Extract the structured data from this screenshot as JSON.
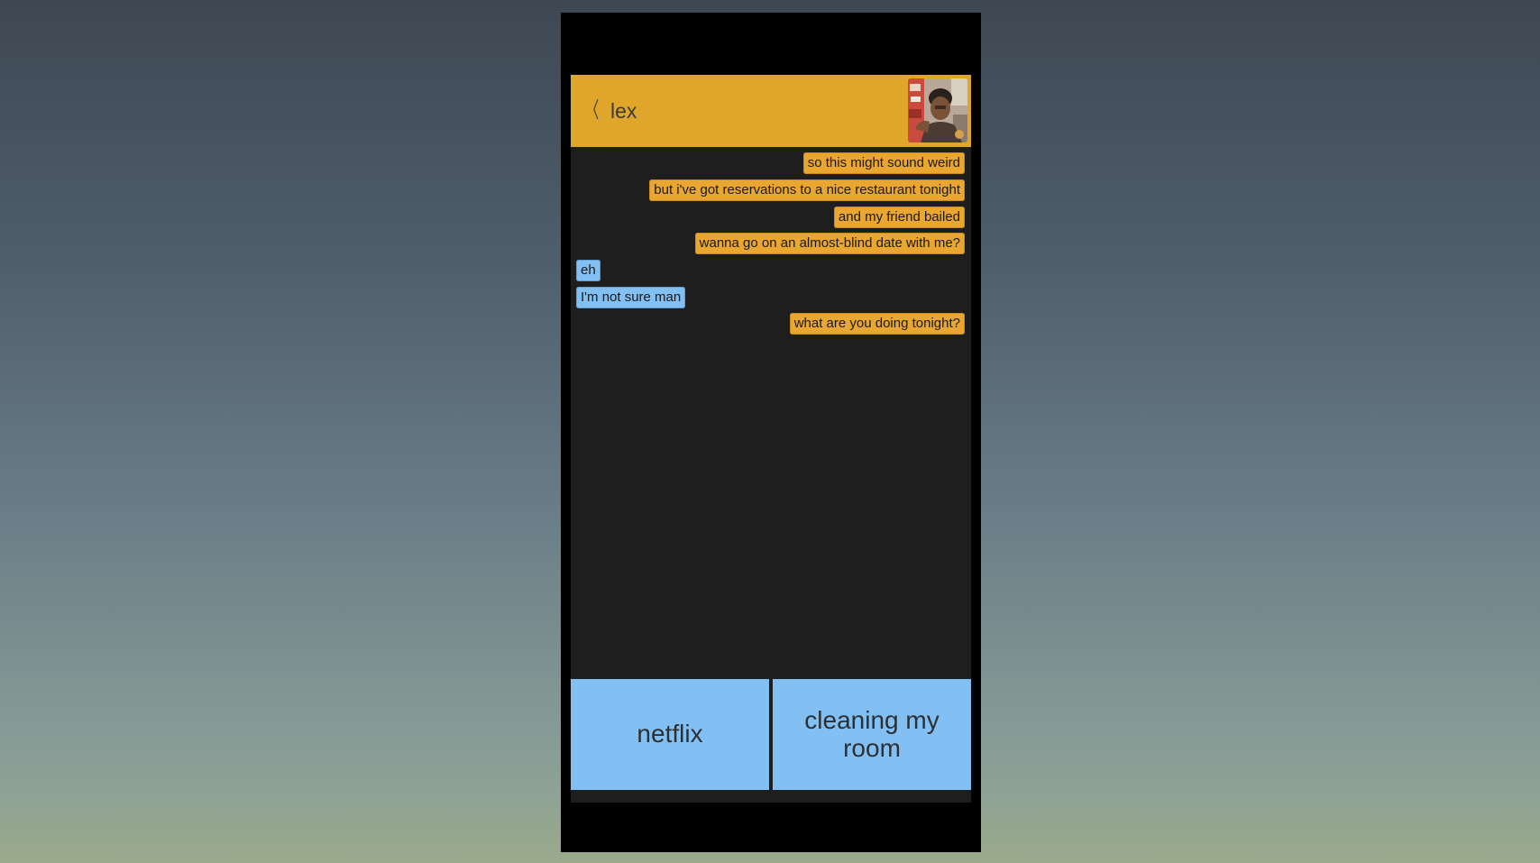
{
  "header": {
    "back_glyph": "〈",
    "contact_name": "lex",
    "avatar_icon": "contact-photo"
  },
  "messages": [
    {
      "from": "me",
      "text": "so this might sound weird"
    },
    {
      "from": "me",
      "text": "but i've got reservations to a nice restaurant tonight"
    },
    {
      "from": "me",
      "text": "and my friend bailed"
    },
    {
      "from": "me",
      "text": "wanna go on an almost-blind date with me?"
    },
    {
      "from": "them",
      "text": "eh"
    },
    {
      "from": "them",
      "text": "I'm not sure man"
    },
    {
      "from": "me",
      "text": "what are you doing tonight?"
    }
  ],
  "choices": [
    {
      "label": "netflix"
    },
    {
      "label": "cleaning my room"
    }
  ],
  "colors": {
    "header": "#e0a52b",
    "sent_bubble": "#e9a630",
    "received_bubble": "#82bff2",
    "choice_button": "#82c0f3",
    "screen_background": "#1e1e1e"
  }
}
